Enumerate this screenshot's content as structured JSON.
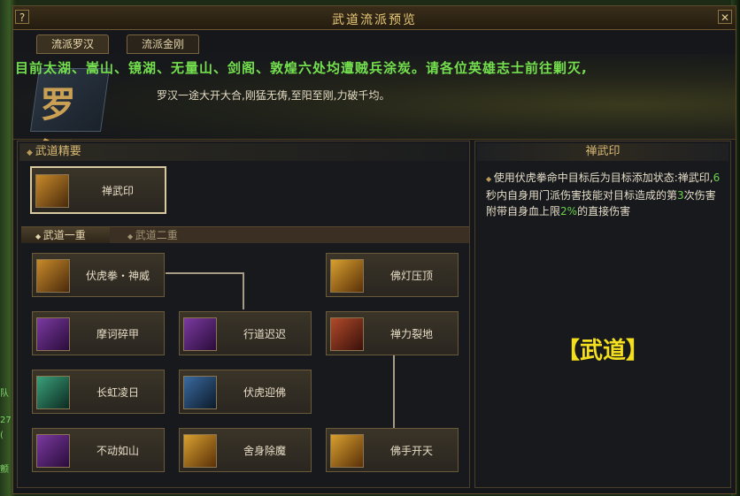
{
  "window": {
    "title": "武道流派预览",
    "help": "?",
    "close": "✕"
  },
  "tabs": [
    {
      "label": "流派罗汉"
    },
    {
      "label": "流派金刚"
    }
  ],
  "marquee": "目前太湖、嵩山、镜湖、无量山、剑阁、敦煌六处均遭贼兵涂炭。请各位英雄志士前往剿灭,",
  "banner": {
    "emblem": "罗汉",
    "description": "罗汉一途大开大合,刚猛无俦,至阳至刚,力破千均。"
  },
  "left_edge_text": [
    "队",
    "27",
    "(",
    "颤"
  ],
  "essentials": {
    "header": "武道精要",
    "skill": {
      "name": "禅武印",
      "icon": "fist-icon"
    }
  },
  "tiers": [
    {
      "label": "武道一重"
    },
    {
      "label": "武道二重"
    }
  ],
  "skills": [
    {
      "name": "伏虎拳・神威",
      "icon": "fist-icon"
    },
    {
      "name": "佛灯压顶",
      "icon": "lamp-icon"
    },
    {
      "name": "摩诃碎甲",
      "icon": "swastika-icon"
    },
    {
      "name": "行道迟迟",
      "icon": "palm-icon"
    },
    {
      "name": "禅力裂地",
      "icon": "arm-icon"
    },
    {
      "name": "长虹凌日",
      "icon": "swirl-icon"
    },
    {
      "name": "伏虎迎佛",
      "icon": "fist-icon"
    },
    {
      "name": "不动如山",
      "icon": "tiger-icon"
    },
    {
      "name": "舍身除魔",
      "icon": "monk-icon"
    },
    {
      "name": "佛手开天",
      "icon": "hand-icon"
    }
  ],
  "detail": {
    "header": "禅武印",
    "desc_part1": "使用伏虎拳命中目标后为目标添加状态:禅武印,",
    "num1": "6",
    "desc_part2": "秒内自身用门派伤害技能对目标造成的第",
    "num2": "3",
    "desc_part3": "次伤害附带自身血上限",
    "num3": "2%",
    "desc_part4": "的直接伤害",
    "bottom_label": "【武道】"
  }
}
